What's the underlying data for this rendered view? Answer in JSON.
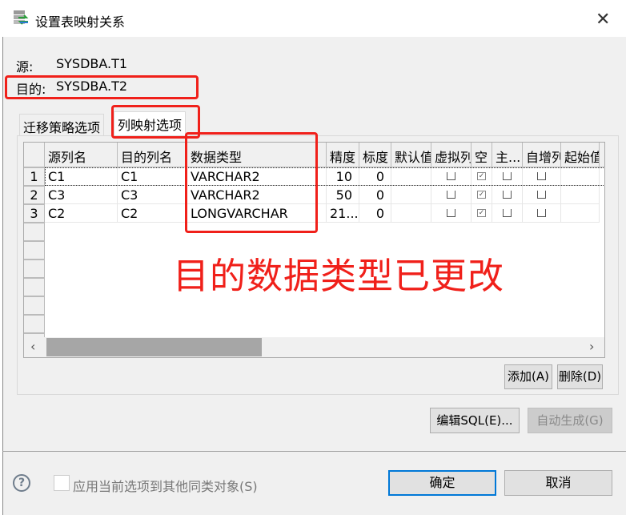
{
  "window": {
    "title": "设置表映射关系",
    "close_icon": "close-icon"
  },
  "source": {
    "label": "源:",
    "value": "SYSDBA.T1"
  },
  "target": {
    "label": "目的:",
    "value": "SYSDBA.T2"
  },
  "tabs": [
    {
      "label": "迁移策略选项",
      "selected": false
    },
    {
      "label": "列映射选项",
      "selected": true
    }
  ],
  "grid": {
    "columns": [
      "源列名",
      "目的列名",
      "数据类型",
      "精度",
      "标度",
      "默认值",
      "虚拟列",
      "空",
      "主...",
      "自增列",
      "起始值"
    ],
    "rows": [
      {
        "num": "1",
        "src": "C1",
        "dst": "C1",
        "type": "VARCHAR2",
        "precision": "10",
        "scale": "0",
        "virtual": false,
        "nullable": true,
        "primary": false,
        "autoinc": false
      },
      {
        "num": "2",
        "src": "C3",
        "dst": "C3",
        "type": "VARCHAR2",
        "precision": "50",
        "scale": "0",
        "virtual": false,
        "nullable": true,
        "primary": false,
        "autoinc": false
      },
      {
        "num": "3",
        "src": "C2",
        "dst": "C2",
        "type": "LONGVARCHAR",
        "precision": "21...",
        "scale": "0",
        "virtual": false,
        "nullable": true,
        "primary": false,
        "autoinc": false
      }
    ]
  },
  "annotation": "目的数据类型已更改",
  "buttons": {
    "add": "添加(A)",
    "delete": "删除(D)",
    "edit_sql": "编辑SQL(E)...",
    "auto_gen": "自动生成(G)",
    "ok": "确定",
    "cancel": "取消"
  },
  "apply_checkbox": {
    "label": "应用当前选项到其他同类对象(S)",
    "checked": false
  },
  "colors": {
    "annotation": "#f0201a",
    "focus": "#0078d7"
  }
}
